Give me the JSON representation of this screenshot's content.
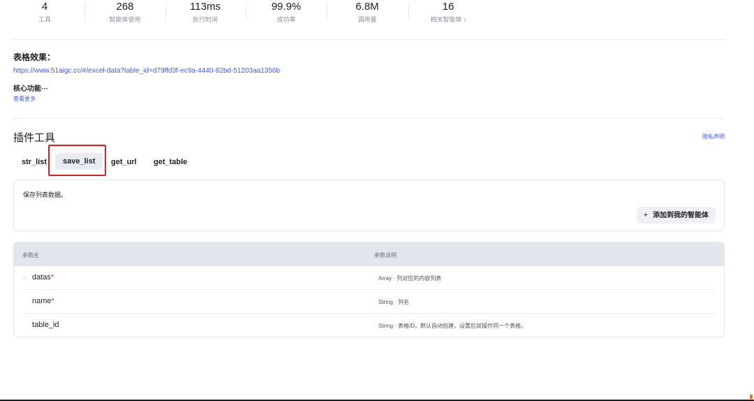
{
  "stats": [
    {
      "value": "4",
      "label": "工具"
    },
    {
      "value": "268",
      "label": "智能体使用"
    },
    {
      "value": "113ms",
      "label": "执行时间"
    },
    {
      "value": "99.9%",
      "label": "成功率"
    },
    {
      "value": "6.8M",
      "label": "调用量"
    },
    {
      "value": "16",
      "label": "相关智能体",
      "chevron": "›"
    }
  ],
  "description": {
    "title": "表格效果：",
    "link": "https://www.51aigc.cc/#/excel-data?table_id=d79ffd3f-ec9a-4440-82bd-51203aa1356b",
    "core": "核心功能···",
    "more": "查看更多"
  },
  "plugin": {
    "title": "插件工具",
    "privacy": "隐私声明",
    "tabs": [
      "str_list",
      "save_list",
      "get_url",
      "get_table"
    ],
    "active_tab": "save_list",
    "tool_description": "保存列表数据。",
    "add_button_icon": "+",
    "add_button": "添加到我的智能体"
  },
  "params": {
    "headers": [
      "参数名",
      "参数说明"
    ],
    "rows": [
      {
        "name": "datas",
        "required": "*",
        "collapsible": true,
        "desc": "Array · 列对应的内容列表"
      },
      {
        "name": "name",
        "required": "*",
        "desc": "String · 列名"
      },
      {
        "name": "table_id",
        "required": "",
        "desc": "String · 表格ID，默认自动创建，设置后就操作同一个表格。"
      }
    ]
  },
  "icons": {
    "caret": "chevron-down-icon",
    "plus": "plus-icon",
    "chevron": "chevron-right-icon"
  },
  "colors": {
    "link": "#3d5af1",
    "required": "#e02020",
    "highlight": "#e02020"
  }
}
